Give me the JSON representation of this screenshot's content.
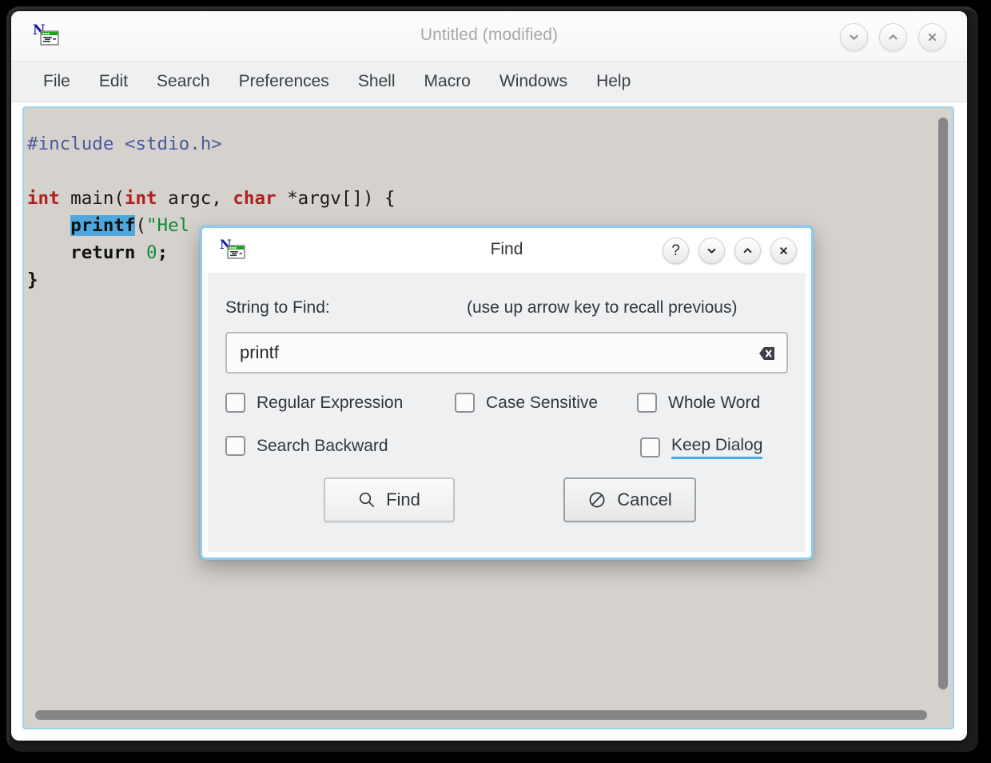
{
  "window": {
    "title": "Untitled (modified)",
    "icon": "nedit-app-icon",
    "controls": [
      {
        "name": "minimize-button",
        "icon": "chevron-down-icon"
      },
      {
        "name": "maximize-button",
        "icon": "chevron-up-icon"
      },
      {
        "name": "close-button",
        "icon": "close-icon"
      }
    ]
  },
  "menubar": {
    "items": [
      {
        "label": "File"
      },
      {
        "label": "Edit"
      },
      {
        "label": "Search"
      },
      {
        "label": "Preferences"
      },
      {
        "label": "Shell"
      },
      {
        "label": "Macro"
      },
      {
        "label": "Windows"
      },
      {
        "label": "Help"
      }
    ]
  },
  "editor": {
    "background": "#d5d2cd",
    "selection_color": "#4fa8dd",
    "focus_border": "#9fd3ef",
    "lines": [
      "#include <stdio.h>",
      "",
      "int main(int argc, char *argv[]) {",
      "    printf(\"Hello, World!\\n\");",
      "    return 0;",
      "}"
    ],
    "selected_text": "printf",
    "vertical_scrollbar": "vertical-scrollbar",
    "horizontal_scrollbar": "horizontal-scrollbar"
  },
  "dialog": {
    "title": "Find",
    "icon": "nedit-app-icon",
    "controls": [
      {
        "name": "help-button",
        "glyph": "?"
      },
      {
        "name": "minimize-button",
        "glyph": "chevron-down-icon"
      },
      {
        "name": "maximize-button",
        "glyph": "chevron-up-icon"
      },
      {
        "name": "close-button",
        "glyph": "close-icon"
      }
    ],
    "string_label": "String to Find:",
    "hint": "(use up arrow key to recall previous)",
    "search_value": "printf",
    "search_placeholder": "",
    "clear_icon": "backspace-clear-icon",
    "checkboxes": [
      {
        "label": "Regular Expression",
        "checked": false,
        "focused": false
      },
      {
        "label": "Case Sensitive",
        "checked": false,
        "focused": false
      },
      {
        "label": "Whole Word",
        "checked": false,
        "focused": false
      },
      {
        "label": "Search Backward",
        "checked": false,
        "focused": false
      },
      {
        "label": "Keep Dialog",
        "checked": false,
        "focused": true
      }
    ],
    "buttons": [
      {
        "label": "Find",
        "icon": "search-icon",
        "default": false
      },
      {
        "label": "Cancel",
        "icon": "no-entry-icon",
        "default": true
      }
    ],
    "accent_color": "#3daee9",
    "body_background": "#eff0f1"
  }
}
